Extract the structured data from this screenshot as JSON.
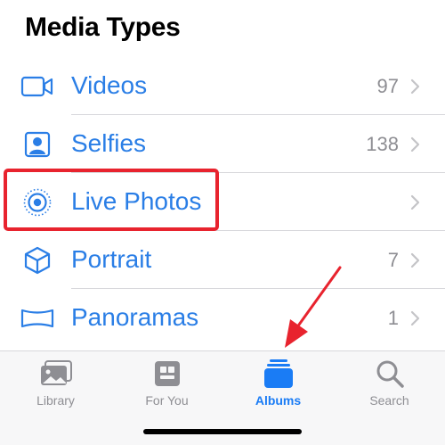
{
  "section": {
    "title": "Media Types"
  },
  "rows": [
    {
      "label": "Videos",
      "count": "97",
      "icon": "video-camera-icon"
    },
    {
      "label": "Selfies",
      "count": "138",
      "icon": "selfie-portrait-icon"
    },
    {
      "label": "Live Photos",
      "count": "",
      "icon": "live-photo-icon"
    },
    {
      "label": "Portrait",
      "count": "7",
      "icon": "portrait-cube-icon"
    },
    {
      "label": "Panoramas",
      "count": "1",
      "icon": "panorama-icon"
    }
  ],
  "tabbar": {
    "tabs": [
      {
        "label": "Library",
        "icon": "library-photos-icon",
        "active": false
      },
      {
        "label": "For You",
        "icon": "for-you-icon",
        "active": false
      },
      {
        "label": "Albums",
        "icon": "albums-stack-icon",
        "active": true
      },
      {
        "label": "Search",
        "icon": "search-icon",
        "active": false
      }
    ]
  },
  "colors": {
    "accent": "#1a7cf5",
    "row_text": "#2a7ee6",
    "secondary": "#8e8e93",
    "highlight": "#e8232e",
    "divider": "#d8d8dc"
  },
  "annotations": {
    "highlight_target": "Live Photos",
    "arrow_target": "Albums"
  }
}
